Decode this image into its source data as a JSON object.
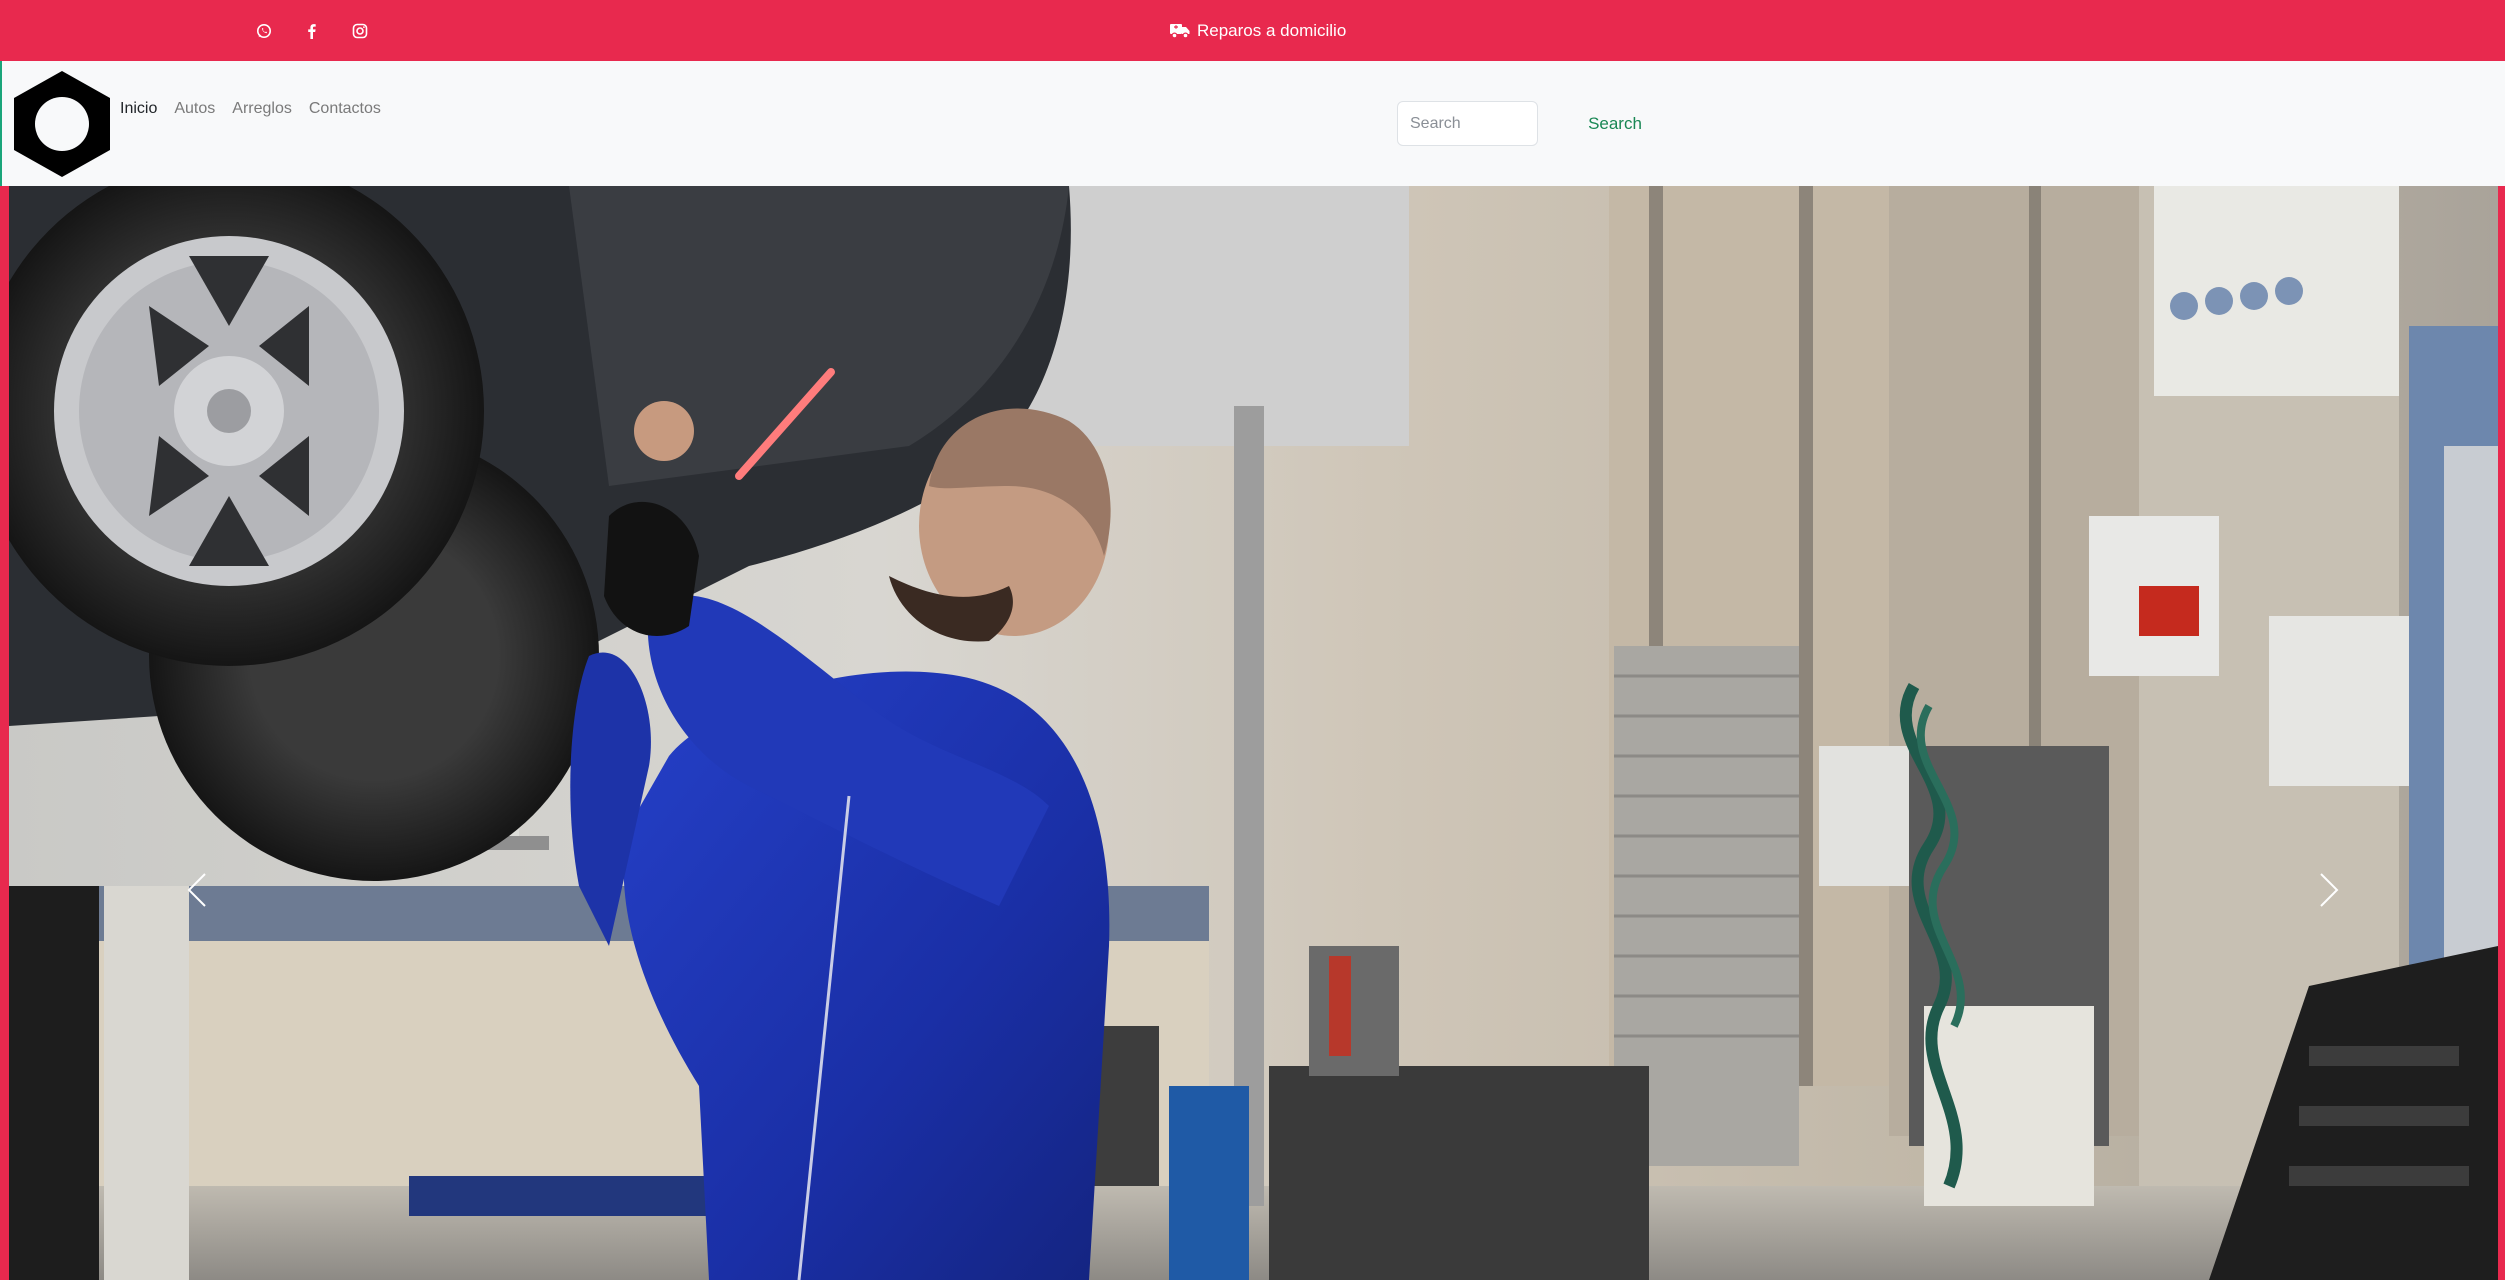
{
  "topbar": {
    "background": "#e8294e",
    "social_icons": [
      "whatsapp-icon",
      "facebook-icon",
      "instagram-icon"
    ],
    "promo_icon": "truck-icon",
    "promo_text": "Reparos a domicilio"
  },
  "navbar": {
    "logo": "hex-nut-logo",
    "links": [
      {
        "label": "Inicio",
        "active": true
      },
      {
        "label": "Autos",
        "active": false
      },
      {
        "label": "Arreglos",
        "active": false
      },
      {
        "label": "Contactos",
        "active": false
      }
    ],
    "search": {
      "placeholder": "Search",
      "value": "",
      "button_label": "Search"
    }
  },
  "hero": {
    "image": "mechanic-working-under-lifted-car-in-garage",
    "prev_icon": "chevron-left-icon",
    "next_icon": "chevron-right-icon"
  },
  "colors": {
    "brand_red": "#e8294e",
    "search_green": "#198754",
    "navbar_bg": "#f8f9fa"
  }
}
